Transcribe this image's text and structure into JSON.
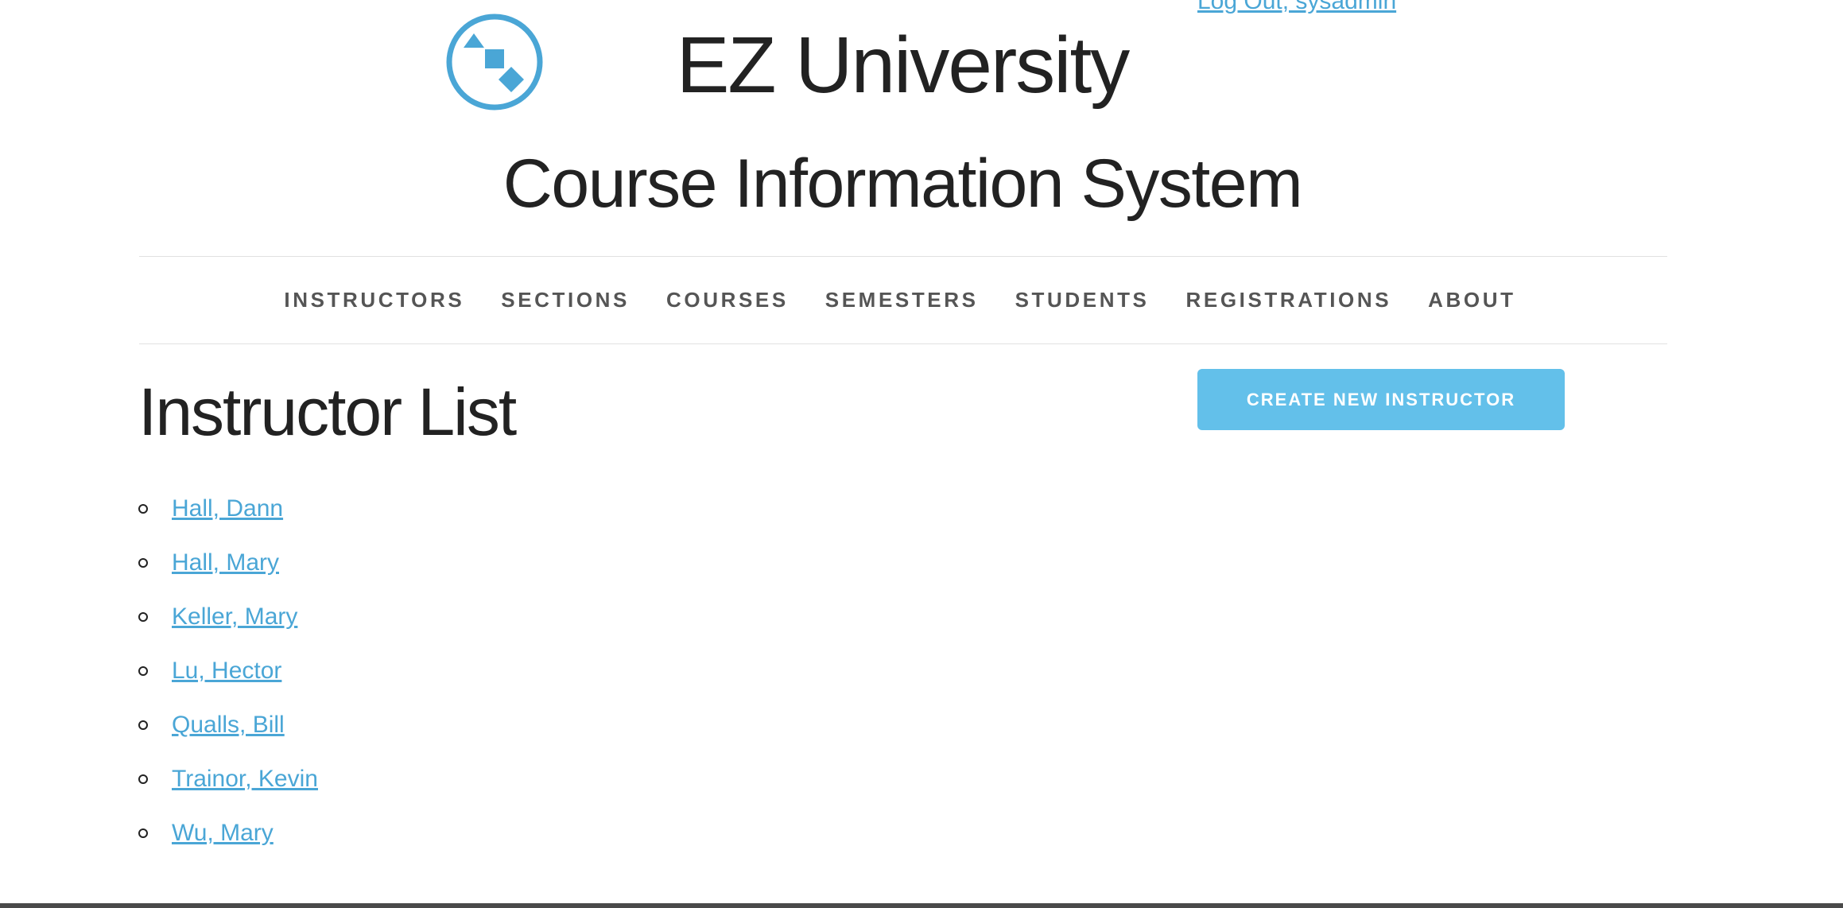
{
  "header": {
    "site_title": "EZ University",
    "site_subtitle": "Course Information System",
    "logout_label": "Log Out, sysadmin",
    "logo_icon": "shapes-logo-icon",
    "accent_color": "#4aa6d6"
  },
  "nav": {
    "items": [
      {
        "label": "INSTRUCTORS"
      },
      {
        "label": "SECTIONS"
      },
      {
        "label": "COURSES"
      },
      {
        "label": "SEMESTERS"
      },
      {
        "label": "STUDENTS"
      },
      {
        "label": "REGISTRATIONS"
      },
      {
        "label": "ABOUT"
      }
    ]
  },
  "main": {
    "page_title": "Instructor List",
    "create_button_label": "CREATE NEW INSTRUCTOR",
    "create_button_color": "#63c0ea",
    "instructors": [
      {
        "name": "Hall, Dann"
      },
      {
        "name": "Hall, Mary"
      },
      {
        "name": "Keller, Mary"
      },
      {
        "name": "Lu, Hector"
      },
      {
        "name": "Qualls, Bill"
      },
      {
        "name": "Trainor, Kevin"
      },
      {
        "name": "Wu, Mary"
      }
    ]
  }
}
